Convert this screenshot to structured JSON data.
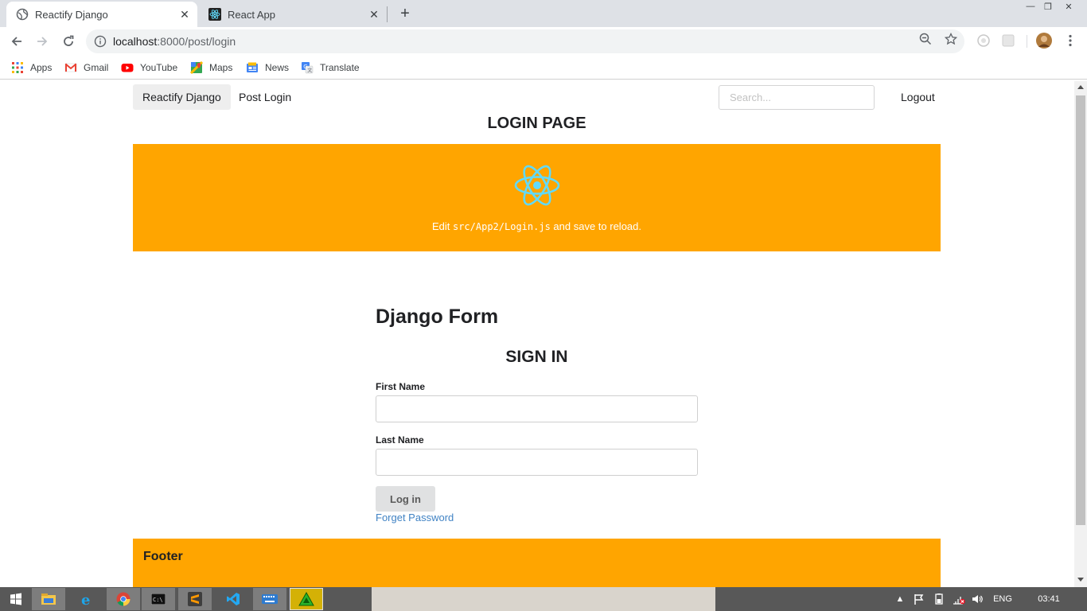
{
  "browser": {
    "tabs": [
      {
        "title": "Reactify Django",
        "icon": "globe-icon",
        "active": true
      },
      {
        "title": "React App",
        "icon": "react-icon",
        "active": false
      }
    ],
    "url": {
      "host": "localhost",
      "path": ":8000/post/login"
    },
    "bookmarks": [
      {
        "label": "Apps",
        "icon": "apps-grid-icon"
      },
      {
        "label": "Gmail",
        "icon": "gmail-icon"
      },
      {
        "label": "YouTube",
        "icon": "youtube-icon"
      },
      {
        "label": "Maps",
        "icon": "maps-icon"
      },
      {
        "label": "News",
        "icon": "news-icon"
      },
      {
        "label": "Translate",
        "icon": "translate-icon"
      }
    ]
  },
  "page": {
    "nav": {
      "brand": "Reactify Django",
      "post_login": "Post Login",
      "search_placeholder": "Search...",
      "logout": "Logout"
    },
    "title": "LOGIN PAGE",
    "react_header": {
      "edit_prefix": "Edit ",
      "code": "src/App2/Login.js",
      "edit_suffix": " and save to reload."
    },
    "form": {
      "heading": "Django Form",
      "subheading": "SIGN IN",
      "first_name_label": "First Name",
      "first_name_value": "",
      "last_name_label": "Last Name",
      "last_name_value": "",
      "submit": "Log in",
      "forgot": "Forget Password"
    },
    "footer": {
      "title": "Footer"
    }
  },
  "taskbar": {
    "language": "ENG",
    "time": "03:41"
  },
  "colors": {
    "accent_orange": "#ffa500",
    "react_cyan": "#61dafb",
    "link_blue": "#4183c4"
  }
}
